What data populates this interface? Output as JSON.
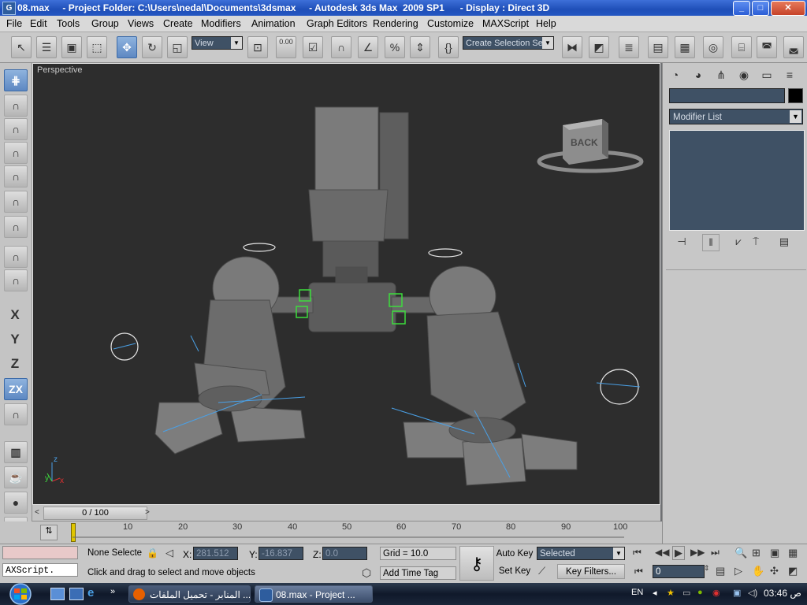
{
  "window": {
    "title": "08.max     - Project Folder: C:\\Users\\nedal\\Documents\\3dsmax     - Autodesk 3ds Max  2009 SP1      - Display : Direct 3D",
    "min": "_",
    "max": "□",
    "close": "✕"
  },
  "menu": [
    "File",
    "Edit",
    "Tools",
    "Group",
    "Views",
    "Create",
    "Modifiers",
    "Animation",
    "Graph Editors",
    "Rendering",
    "Customize",
    "MAXScript",
    "Help"
  ],
  "toolbar": {
    "ref_coord": "View",
    "selection_set": "Create Selection Set",
    "snap_value": "0.00"
  },
  "left_axes": [
    "X",
    "Y",
    "Z",
    "ZX"
  ],
  "viewport": {
    "label": "Perspective",
    "viewcube_face": "BACK",
    "axis_labels": [
      "x",
      "y",
      "z"
    ]
  },
  "command_panel": {
    "modifier_list": "Modifier List"
  },
  "timeslider": {
    "position": "0 / 100",
    "left_arrow": "<",
    "right_arrow": ">"
  },
  "trackbar": {
    "ticks": [
      "10",
      "20",
      "30",
      "40",
      "50",
      "60",
      "70",
      "80",
      "90",
      "100"
    ]
  },
  "status": {
    "maxscript_label": "AXScript.",
    "selection": "None Selecte",
    "x_label": "X:",
    "x_value": "281.512",
    "y_label": "Y:",
    "y_value": "-16.837",
    "z_label": "Z:",
    "z_value": "0.0",
    "grid": "Grid = 10.0",
    "prompt": "Click and drag to select and move objects",
    "add_time_tag": "Add Time Tag",
    "auto_key": "Auto Key",
    "set_key": "Set Key",
    "selected": "Selected",
    "key_filters": "Key Filters...",
    "frame": "0"
  },
  "taskbar": {
    "tasks": [
      {
        "label": "المنابر - تحميل الملفات ..."
      },
      {
        "label": "08.max     - Project ..."
      }
    ],
    "language": "EN",
    "clock": "ص 03:46"
  },
  "colors": {
    "viewport_bg": "#2d2d2d",
    "panel_gray": "#c7c7c7",
    "field_dark": "#3f5165",
    "active_blue": "#5d88c2",
    "selection_green": "#3ddc3d",
    "helper_blue": "#4aa0e6"
  }
}
